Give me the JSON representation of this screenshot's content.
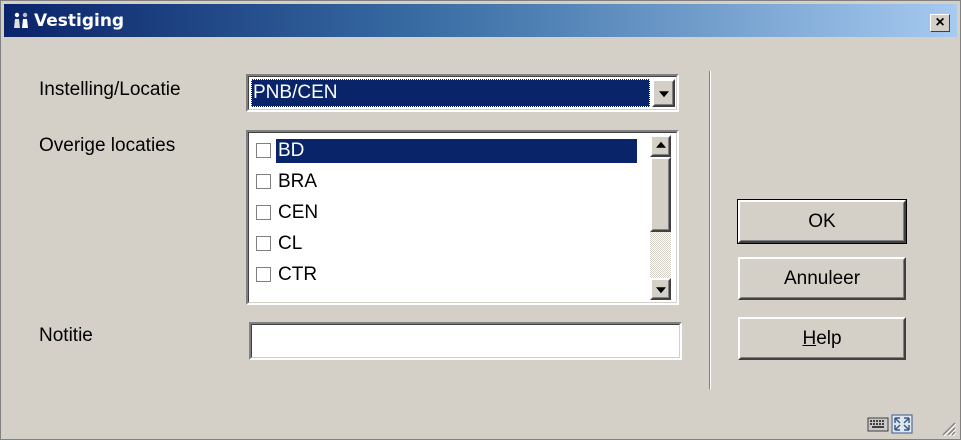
{
  "window": {
    "title": "Vestiging",
    "close_label": "×"
  },
  "form": {
    "instelling_label": "Instelling/Locatie",
    "instelling_value": "PNB/CEN",
    "overige_label": "Overige locaties",
    "overige_items": [
      {
        "label": "BD",
        "checked": false,
        "selected": true
      },
      {
        "label": "BRA",
        "checked": false,
        "selected": false
      },
      {
        "label": "CEN",
        "checked": false,
        "selected": false
      },
      {
        "label": "CL",
        "checked": false,
        "selected": false
      },
      {
        "label": "CTR",
        "checked": false,
        "selected": false
      }
    ],
    "notitie_label": "Notitie",
    "notitie_value": ""
  },
  "buttons": {
    "ok": "OK",
    "cancel": "Annuleer",
    "help_mnemonic": "H",
    "help_rest": "elp"
  },
  "statusbar": {
    "icons": [
      "keyboard-icon",
      "resize-window-icon"
    ]
  },
  "colors": {
    "titlebar_start": "#0a246a",
    "titlebar_end": "#a6caf0",
    "selection": "#0a246a",
    "face": "#d4d0c8"
  }
}
